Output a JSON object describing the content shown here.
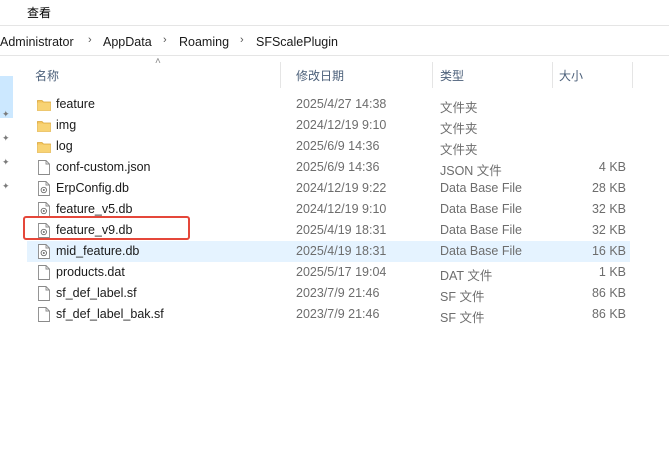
{
  "menu": {
    "view_label": "查看"
  },
  "breadcrumb": [
    "Administrator",
    "AppData",
    "Roaming",
    "SFScalePlugin"
  ],
  "columns": {
    "name": "名称",
    "modified": "修改日期",
    "type": "类型",
    "size": "大小"
  },
  "files": [
    {
      "name": "feature",
      "modified": "2025/4/27 14:38",
      "type": "文件夹",
      "size": "",
      "icon": "folder-icon"
    },
    {
      "name": "img",
      "modified": "2024/12/19 9:10",
      "type": "文件夹",
      "size": "",
      "icon": "folder-icon"
    },
    {
      "name": "log",
      "modified": "2025/6/9 14:36",
      "type": "文件夹",
      "size": "",
      "icon": "folder-icon"
    },
    {
      "name": "conf-custom.json",
      "modified": "2025/6/9 14:36",
      "type": "JSON 文件",
      "size": "4 KB",
      "icon": "file-icon"
    },
    {
      "name": "ErpConfig.db",
      "modified": "2024/12/19 9:22",
      "type": "Data Base File",
      "size": "28 KB",
      "icon": "db-file-icon"
    },
    {
      "name": "feature_v5.db",
      "modified": "2024/12/19 9:10",
      "type": "Data Base File",
      "size": "32 KB",
      "icon": "db-file-icon"
    },
    {
      "name": "feature_v9.db",
      "modified": "2025/4/19 18:31",
      "type": "Data Base File",
      "size": "32 KB",
      "icon": "db-file-icon"
    },
    {
      "name": "mid_feature.db",
      "modified": "2025/4/19 18:31",
      "type": "Data Base File",
      "size": "16 KB",
      "icon": "db-file-icon"
    },
    {
      "name": "products.dat",
      "modified": "2025/5/17 19:04",
      "type": "DAT 文件",
      "size": "1 KB",
      "icon": "file-icon"
    },
    {
      "name": "sf_def_label.sf",
      "modified": "2023/7/9 21:46",
      "type": "SF 文件",
      "size": "86 KB",
      "icon": "file-icon"
    },
    {
      "name": "sf_def_label_bak.sf",
      "modified": "2023/7/9 21:46",
      "type": "SF 文件",
      "size": "86 KB",
      "icon": "file-icon"
    }
  ],
  "highlighted_row": "mid_feature.db",
  "annotated_row": "feature_v9.db",
  "colors": {
    "folder": "#f5c55b",
    "hover": "#e5f3ff",
    "annotation": "#e5473a",
    "header_text": "#4c607a"
  }
}
